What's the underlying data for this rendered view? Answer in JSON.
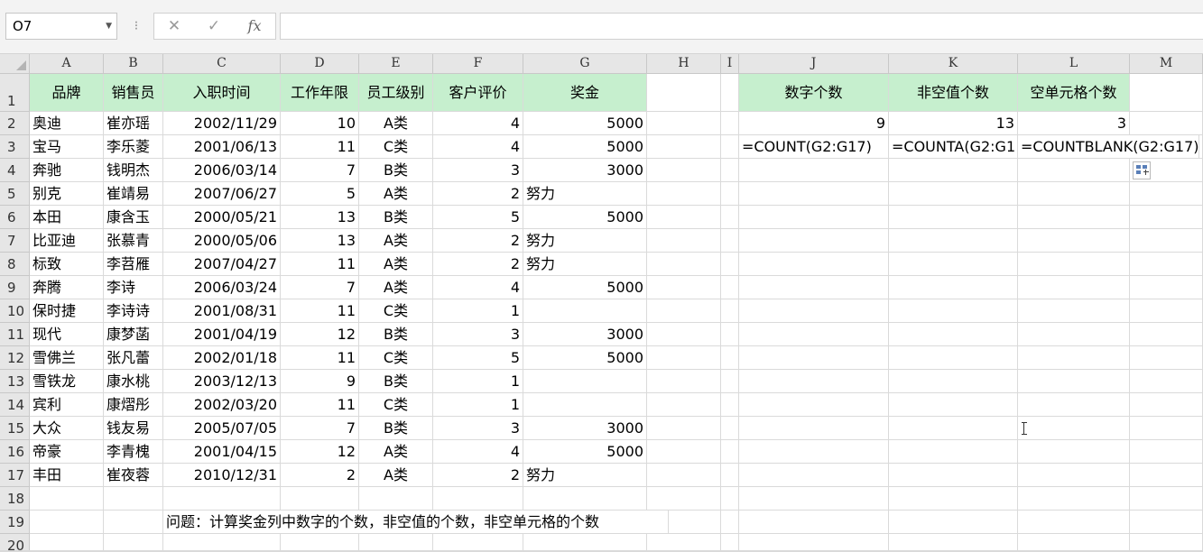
{
  "name_box": {
    "value": "O7"
  },
  "formula_bar": {
    "cancel_icon": "✕",
    "enter_icon": "✓",
    "fx_label": "fx",
    "value": ""
  },
  "columns": [
    "A",
    "B",
    "C",
    "D",
    "E",
    "F",
    "G",
    "H",
    "I",
    "J",
    "K",
    "L",
    "M"
  ],
  "rows": [
    "1",
    "2",
    "3",
    "4",
    "5",
    "6",
    "7",
    "8",
    "9",
    "10",
    "11",
    "12",
    "13",
    "14",
    "15",
    "16",
    "17",
    "18",
    "19",
    "20"
  ],
  "table": {
    "headers": [
      "品牌",
      "销售员",
      "入职时间",
      "工作年限",
      "员工级别",
      "客户评价",
      "奖金"
    ],
    "rows": [
      [
        "奥迪",
        "崔亦瑶",
        "2002/11/29",
        "10",
        "A类",
        "4",
        "5000"
      ],
      [
        "宝马",
        "李乐菱",
        "2001/06/13",
        "11",
        "C类",
        "4",
        "5000"
      ],
      [
        "奔驰",
        "钱明杰",
        "2006/03/14",
        "7",
        "B类",
        "3",
        "3000"
      ],
      [
        "别克",
        "崔靖易",
        "2007/06/27",
        "5",
        "A类",
        "2",
        "努力"
      ],
      [
        "本田",
        "康含玉",
        "2000/05/21",
        "13",
        "B类",
        "5",
        "5000"
      ],
      [
        "比亚迪",
        "张慕青",
        "2000/05/06",
        "13",
        "A类",
        "2",
        "努力"
      ],
      [
        "标致",
        "李苕雁",
        "2007/04/27",
        "11",
        "A类",
        "2",
        "努力"
      ],
      [
        "奔腾",
        "李诗",
        "2006/03/24",
        "7",
        "A类",
        "4",
        "5000"
      ],
      [
        "保时捷",
        "李诗诗",
        "2001/08/31",
        "11",
        "C类",
        "1",
        ""
      ],
      [
        "现代",
        "康梦菡",
        "2001/04/19",
        "12",
        "B类",
        "3",
        "3000"
      ],
      [
        "雪佛兰",
        "张凡蕾",
        "2002/01/18",
        "11",
        "C类",
        "5",
        "5000"
      ],
      [
        "雪铁龙",
        "康水桃",
        "2003/12/13",
        "9",
        "B类",
        "1",
        ""
      ],
      [
        "宾利",
        "康熠彤",
        "2002/03/20",
        "11",
        "C类",
        "1",
        ""
      ],
      [
        "大众",
        "钱友易",
        "2005/07/05",
        "7",
        "B类",
        "3",
        "3000"
      ],
      [
        "帝豪",
        "李青槐",
        "2001/04/15",
        "12",
        "A类",
        "4",
        "5000"
      ],
      [
        "丰田",
        "崔夜蓉",
        "2010/12/31",
        "2",
        "A类",
        "2",
        "努力"
      ]
    ]
  },
  "summary": {
    "headers": [
      "数字个数",
      "非空值个数",
      "空单元格个数"
    ],
    "values": [
      "9",
      "13",
      "3"
    ],
    "formulas": [
      "=COUNT(G2:G17)",
      "=COUNTA(G2:G1",
      "=COUNTBLANK(G2:G17)"
    ]
  },
  "question": "问题：计算奖金列中数字的个数，非空值的个数，非空单元格的个数"
}
